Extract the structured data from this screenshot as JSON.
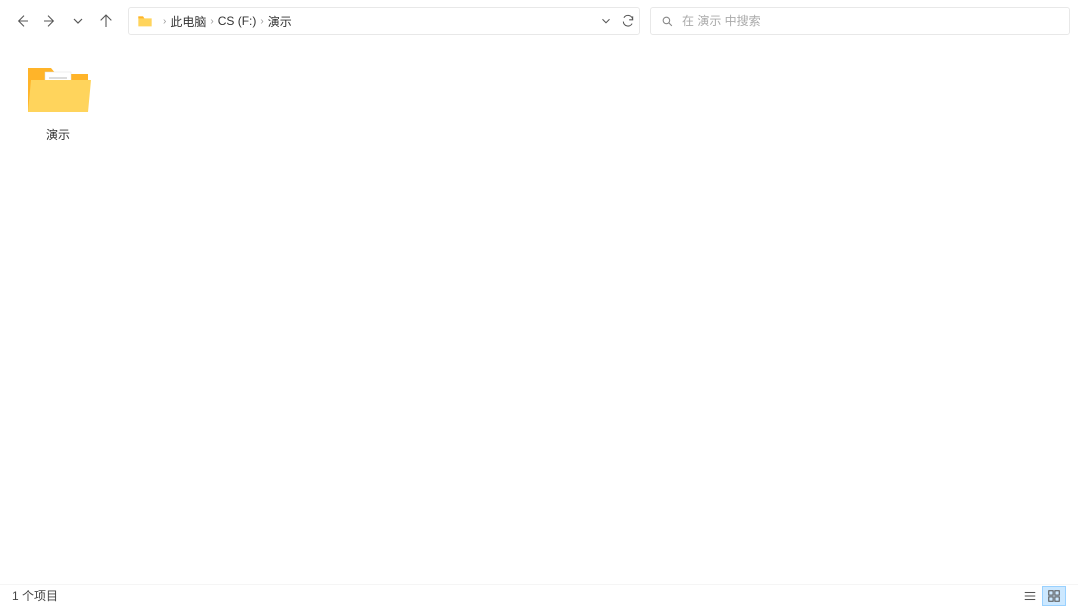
{
  "breadcrumb": {
    "items": [
      "此电脑",
      "CS (F:)",
      "演示"
    ]
  },
  "search": {
    "placeholder": "在 演示 中搜索"
  },
  "items": [
    {
      "name": "演示",
      "type": "folder-with-doc"
    }
  ],
  "status": {
    "count_text": "1 个项目"
  },
  "view": {
    "active": "large-icons"
  }
}
